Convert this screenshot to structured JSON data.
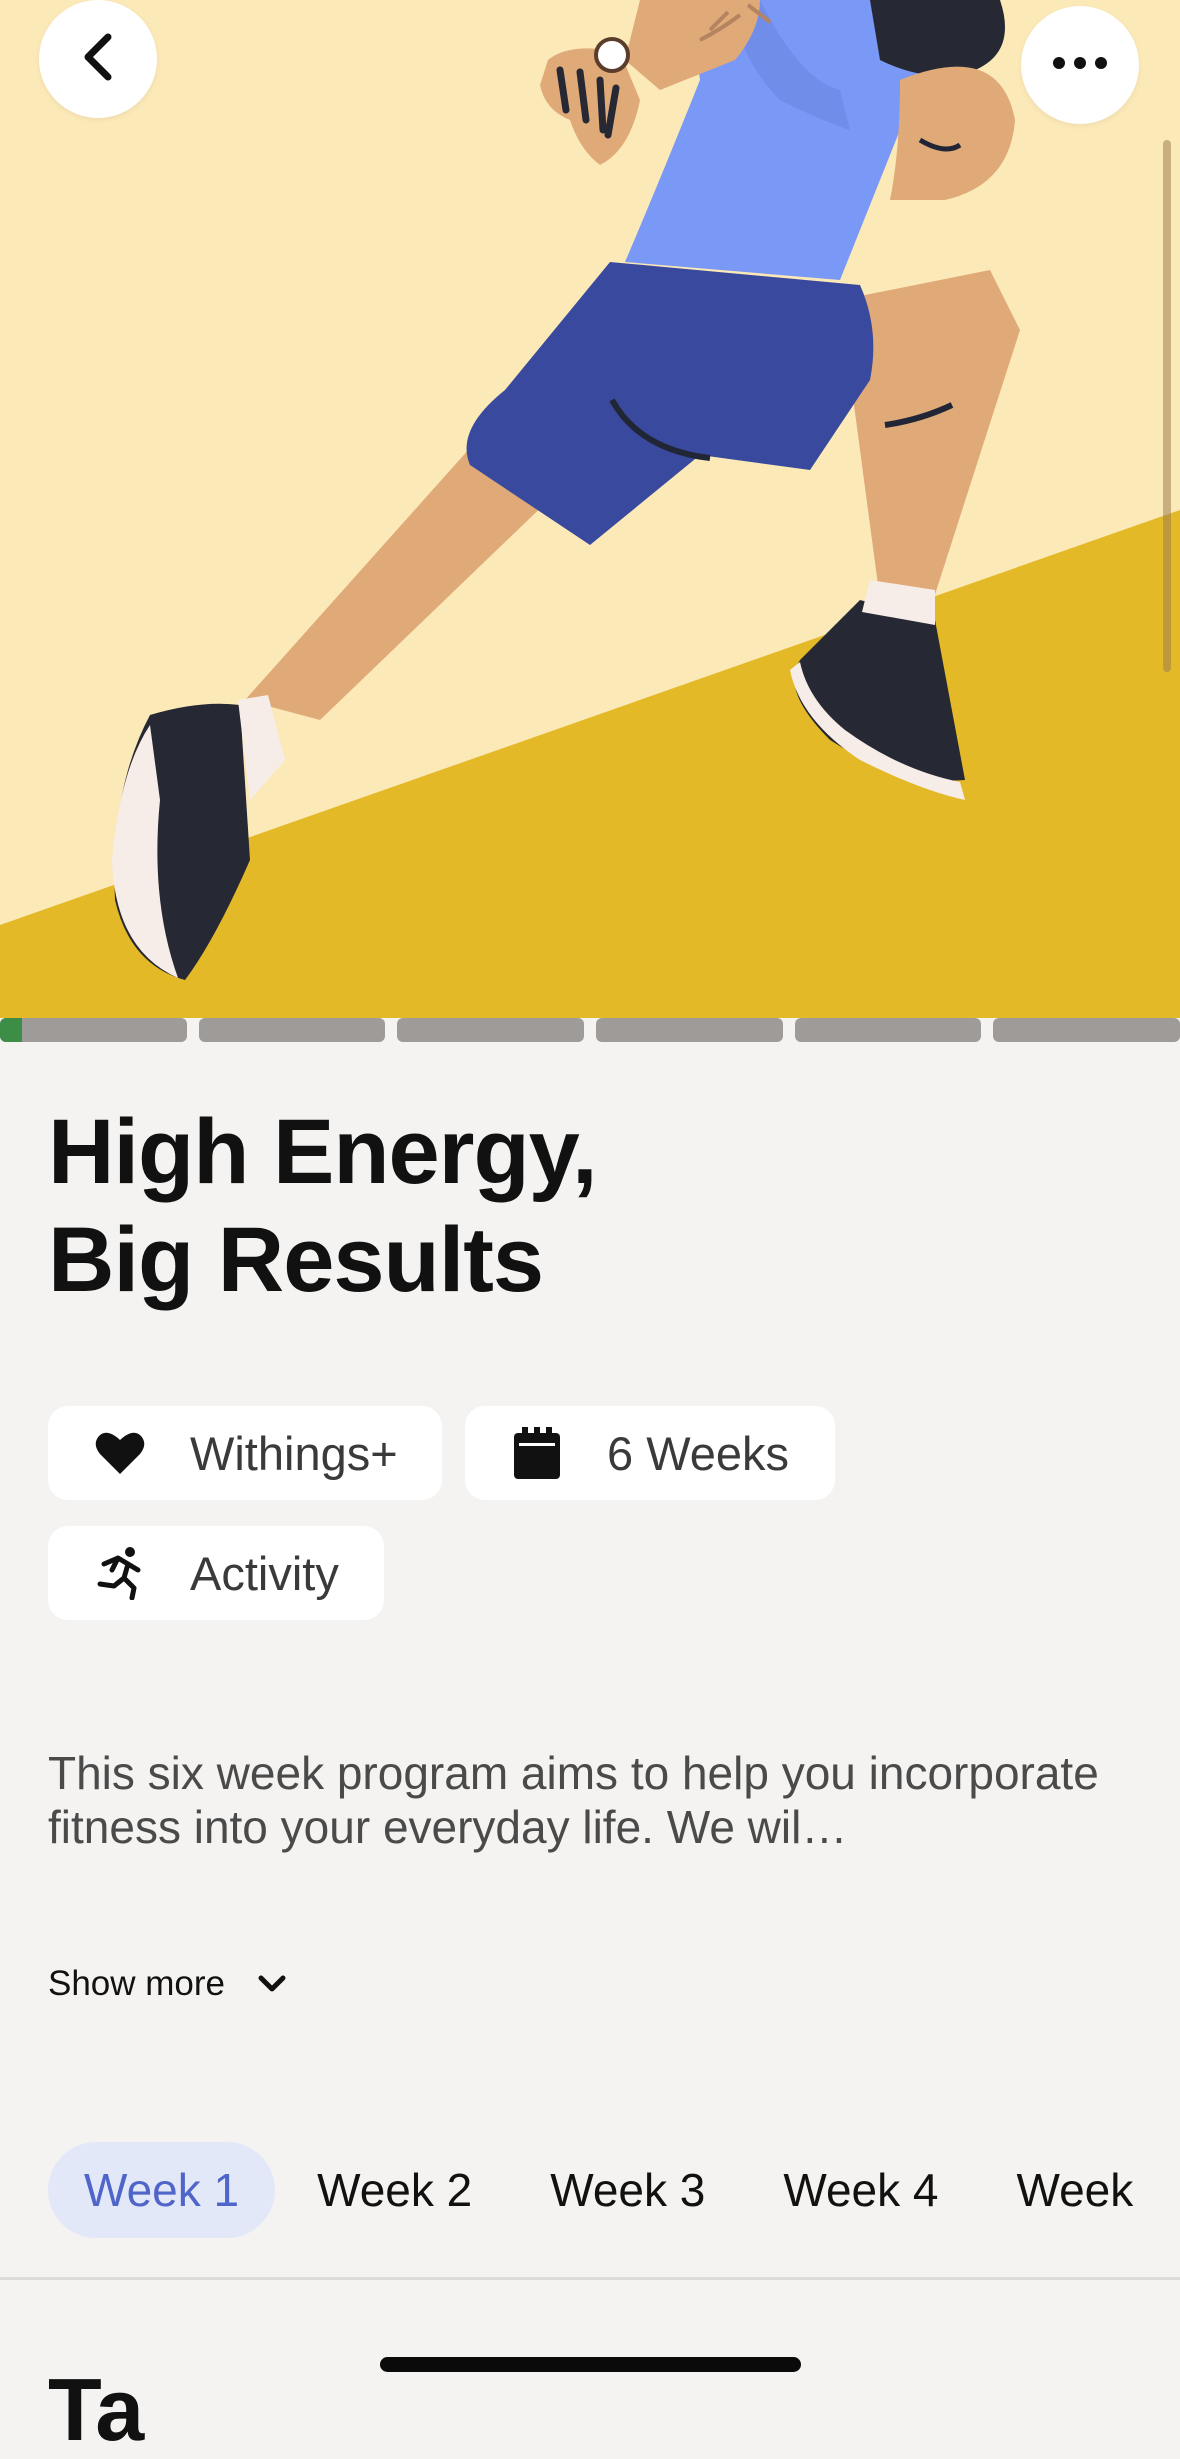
{
  "program": {
    "title": "High Energy,\nBig Results",
    "chips": {
      "membership": "Withings+",
      "duration": "6 Weeks",
      "category": "Activity"
    },
    "description": "This six week program aims to help you incorporate fitness into your everyday life. We wil…",
    "show_more": "Show more"
  },
  "progress": {
    "segments": 6,
    "first_segment_fill": 0.18,
    "fill_color": "#3c8d46"
  },
  "weeks": {
    "tabs": [
      "Week 1",
      "Week 2",
      "Week 3",
      "Week 4",
      "Week"
    ],
    "active_index": 0
  },
  "next_section_peek": "Ta",
  "icons": {
    "back": "back-arrow-icon",
    "more": "more-options-icon",
    "membership": "heart-icon",
    "duration": "calendar-icon",
    "category": "running-person-icon",
    "show_more": "chevron-down-icon"
  },
  "colors": {
    "accent": "#5065c9",
    "active_tab_bg": "#e3e8f8",
    "hero_bg": "#fce9b8",
    "hero_ground": "#e4b928"
  }
}
